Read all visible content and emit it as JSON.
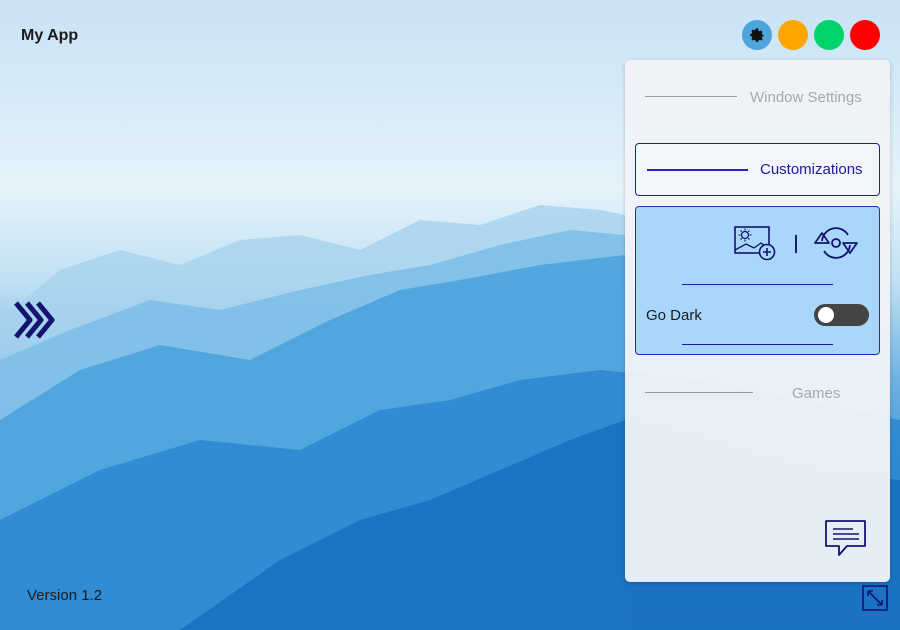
{
  "app": {
    "title": "My App",
    "version": "Version 1.2"
  },
  "window_controls": {
    "settings_color": "#4ea4dc",
    "minimize_color": "#ffa500",
    "maximize_color": "#00d26a",
    "close_color": "#ff0000"
  },
  "side_panel": {
    "window_settings_label": "Window Settings",
    "customizations_label": "Customizations",
    "go_dark_label": "Go Dark",
    "go_dark_on": false,
    "games_label": "Games"
  },
  "icons": [
    "gear-icon",
    "expand-arrow-icon",
    "image-add-icon",
    "sync-icon",
    "chat-icon",
    "resize-icon"
  ]
}
